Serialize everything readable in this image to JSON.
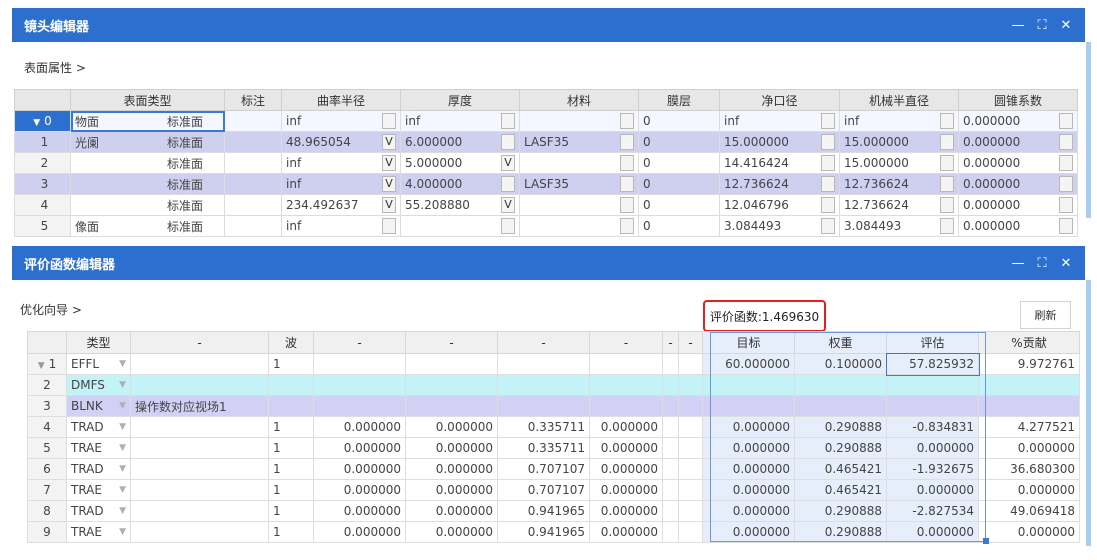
{
  "lens_editor": {
    "title": "镜头编辑器",
    "section_label": "表面属性 >",
    "headers": [
      "",
      "表面类型",
      "标注",
      "曲率半径",
      "厚度",
      "材料",
      "膜层",
      "净口径",
      "机械半直径",
      "圆锥系数"
    ],
    "rows": [
      {
        "id": "0",
        "marker": "▼",
        "label": "物面",
        "type": "标准面",
        "note": "",
        "radius": "inf",
        "radius_solve": "",
        "thickness": "inf",
        "thickness_solve": "",
        "material": "",
        "coating": "0",
        "clear": "inf",
        "mech": "inf",
        "conic": "0.000000"
      },
      {
        "id": "1",
        "marker": "",
        "label": "光阑",
        "type": "标准面",
        "note": "",
        "radius": "48.965054",
        "radius_solve": "V",
        "thickness": "6.000000",
        "thickness_solve": "",
        "material": "LASF35",
        "coating": "0",
        "clear": "15.000000",
        "mech": "15.000000",
        "conic": "0.000000"
      },
      {
        "id": "2",
        "marker": "",
        "label": "",
        "type": "标准面",
        "note": "",
        "radius": "inf",
        "radius_solve": "V",
        "thickness": "5.000000",
        "thickness_solve": "V",
        "material": "",
        "coating": "0",
        "clear": "14.416424",
        "mech": "15.000000",
        "conic": "0.000000"
      },
      {
        "id": "3",
        "marker": "",
        "label": "",
        "type": "标准面",
        "note": "",
        "radius": "inf",
        "radius_solve": "V",
        "thickness": "4.000000",
        "thickness_solve": "",
        "material": "LASF35",
        "coating": "0",
        "clear": "12.736624",
        "mech": "12.736624",
        "conic": "0.000000"
      },
      {
        "id": "4",
        "marker": "",
        "label": "",
        "type": "标准面",
        "note": "",
        "radius": "234.492637",
        "radius_solve": "V",
        "thickness": "55.208880",
        "thickness_solve": "V",
        "material": "",
        "coating": "0",
        "clear": "12.046796",
        "mech": "12.736624",
        "conic": "0.000000"
      },
      {
        "id": "5",
        "marker": "",
        "label": "像面",
        "type": "标准面",
        "note": "",
        "radius": "inf",
        "radius_solve": "",
        "thickness": "",
        "thickness_solve": "",
        "material": "",
        "coating": "0",
        "clear": "3.084493",
        "mech": "3.084493",
        "conic": "0.000000"
      }
    ]
  },
  "merit_editor": {
    "title": "评价函数编辑器",
    "section_label": "优化向导 >",
    "merit_value": "评价函数:1.469630",
    "refresh_label": "刷新",
    "headers": [
      "",
      "类型",
      "-",
      "波",
      "-",
      "-",
      "-",
      "-",
      "-",
      "-",
      "目标",
      "权重",
      "评估",
      "%贡献"
    ],
    "rows": [
      {
        "id": "1",
        "type": "EFFL",
        "c1": "",
        "wave": "1",
        "c3": "",
        "c4": "",
        "c5": "",
        "c6": "",
        "c7": "",
        "c8": "",
        "target": "60.000000",
        "weight": "0.100000",
        "value": "57.825932",
        "contrib": "9.972761"
      },
      {
        "id": "2",
        "type": "DMFS",
        "c1": "",
        "wave": "",
        "c3": "",
        "c4": "",
        "c5": "",
        "c6": "",
        "c7": "",
        "c8": "",
        "target": "",
        "weight": "",
        "value": "",
        "contrib": ""
      },
      {
        "id": "3",
        "type": "BLNK",
        "c1": "操作数对应视场1",
        "wave": "",
        "c3": "",
        "c4": "",
        "c5": "",
        "c6": "",
        "c7": "",
        "c8": "",
        "target": "",
        "weight": "",
        "value": "",
        "contrib": ""
      },
      {
        "id": "4",
        "type": "TRAD",
        "c1": "",
        "wave": "1",
        "c3": "0.000000",
        "c4": "0.000000",
        "c5": "0.335711",
        "c6": "0.000000",
        "c7": "",
        "c8": "",
        "target": "0.000000",
        "weight": "0.290888",
        "value": "-0.834831",
        "contrib": "4.277521"
      },
      {
        "id": "5",
        "type": "TRAE",
        "c1": "",
        "wave": "1",
        "c3": "0.000000",
        "c4": "0.000000",
        "c5": "0.335711",
        "c6": "0.000000",
        "c7": "",
        "c8": "",
        "target": "0.000000",
        "weight": "0.290888",
        "value": "0.000000",
        "contrib": "0.000000"
      },
      {
        "id": "6",
        "type": "TRAD",
        "c1": "",
        "wave": "1",
        "c3": "0.000000",
        "c4": "0.000000",
        "c5": "0.707107",
        "c6": "0.000000",
        "c7": "",
        "c8": "",
        "target": "0.000000",
        "weight": "0.465421",
        "value": "-1.932675",
        "contrib": "36.680300"
      },
      {
        "id": "7",
        "type": "TRAE",
        "c1": "",
        "wave": "1",
        "c3": "0.000000",
        "c4": "0.000000",
        "c5": "0.707107",
        "c6": "0.000000",
        "c7": "",
        "c8": "",
        "target": "0.000000",
        "weight": "0.465421",
        "value": "0.000000",
        "contrib": "0.000000"
      },
      {
        "id": "8",
        "type": "TRAD",
        "c1": "",
        "wave": "1",
        "c3": "0.000000",
        "c4": "0.000000",
        "c5": "0.941965",
        "c6": "0.000000",
        "c7": "",
        "c8": "",
        "target": "0.000000",
        "weight": "0.290888",
        "value": "-2.827534",
        "contrib": "49.069418"
      },
      {
        "id": "9",
        "type": "TRAE",
        "c1": "",
        "wave": "1",
        "c3": "0.000000",
        "c4": "0.000000",
        "c5": "0.941965",
        "c6": "0.000000",
        "c7": "",
        "c8": "",
        "target": "0.000000",
        "weight": "0.290888",
        "value": "0.000000",
        "contrib": "0.000000"
      }
    ]
  },
  "window_controls": {
    "minimize": "—",
    "maximize": "⛶",
    "close": "✕"
  },
  "colors": {
    "titlebar": "#2d6fce",
    "shaded_row": "#cfcfef",
    "cyan_row": "#c3f3f7",
    "lavender_row": "#d3d0f5",
    "highlight_box": "#e0241b"
  }
}
